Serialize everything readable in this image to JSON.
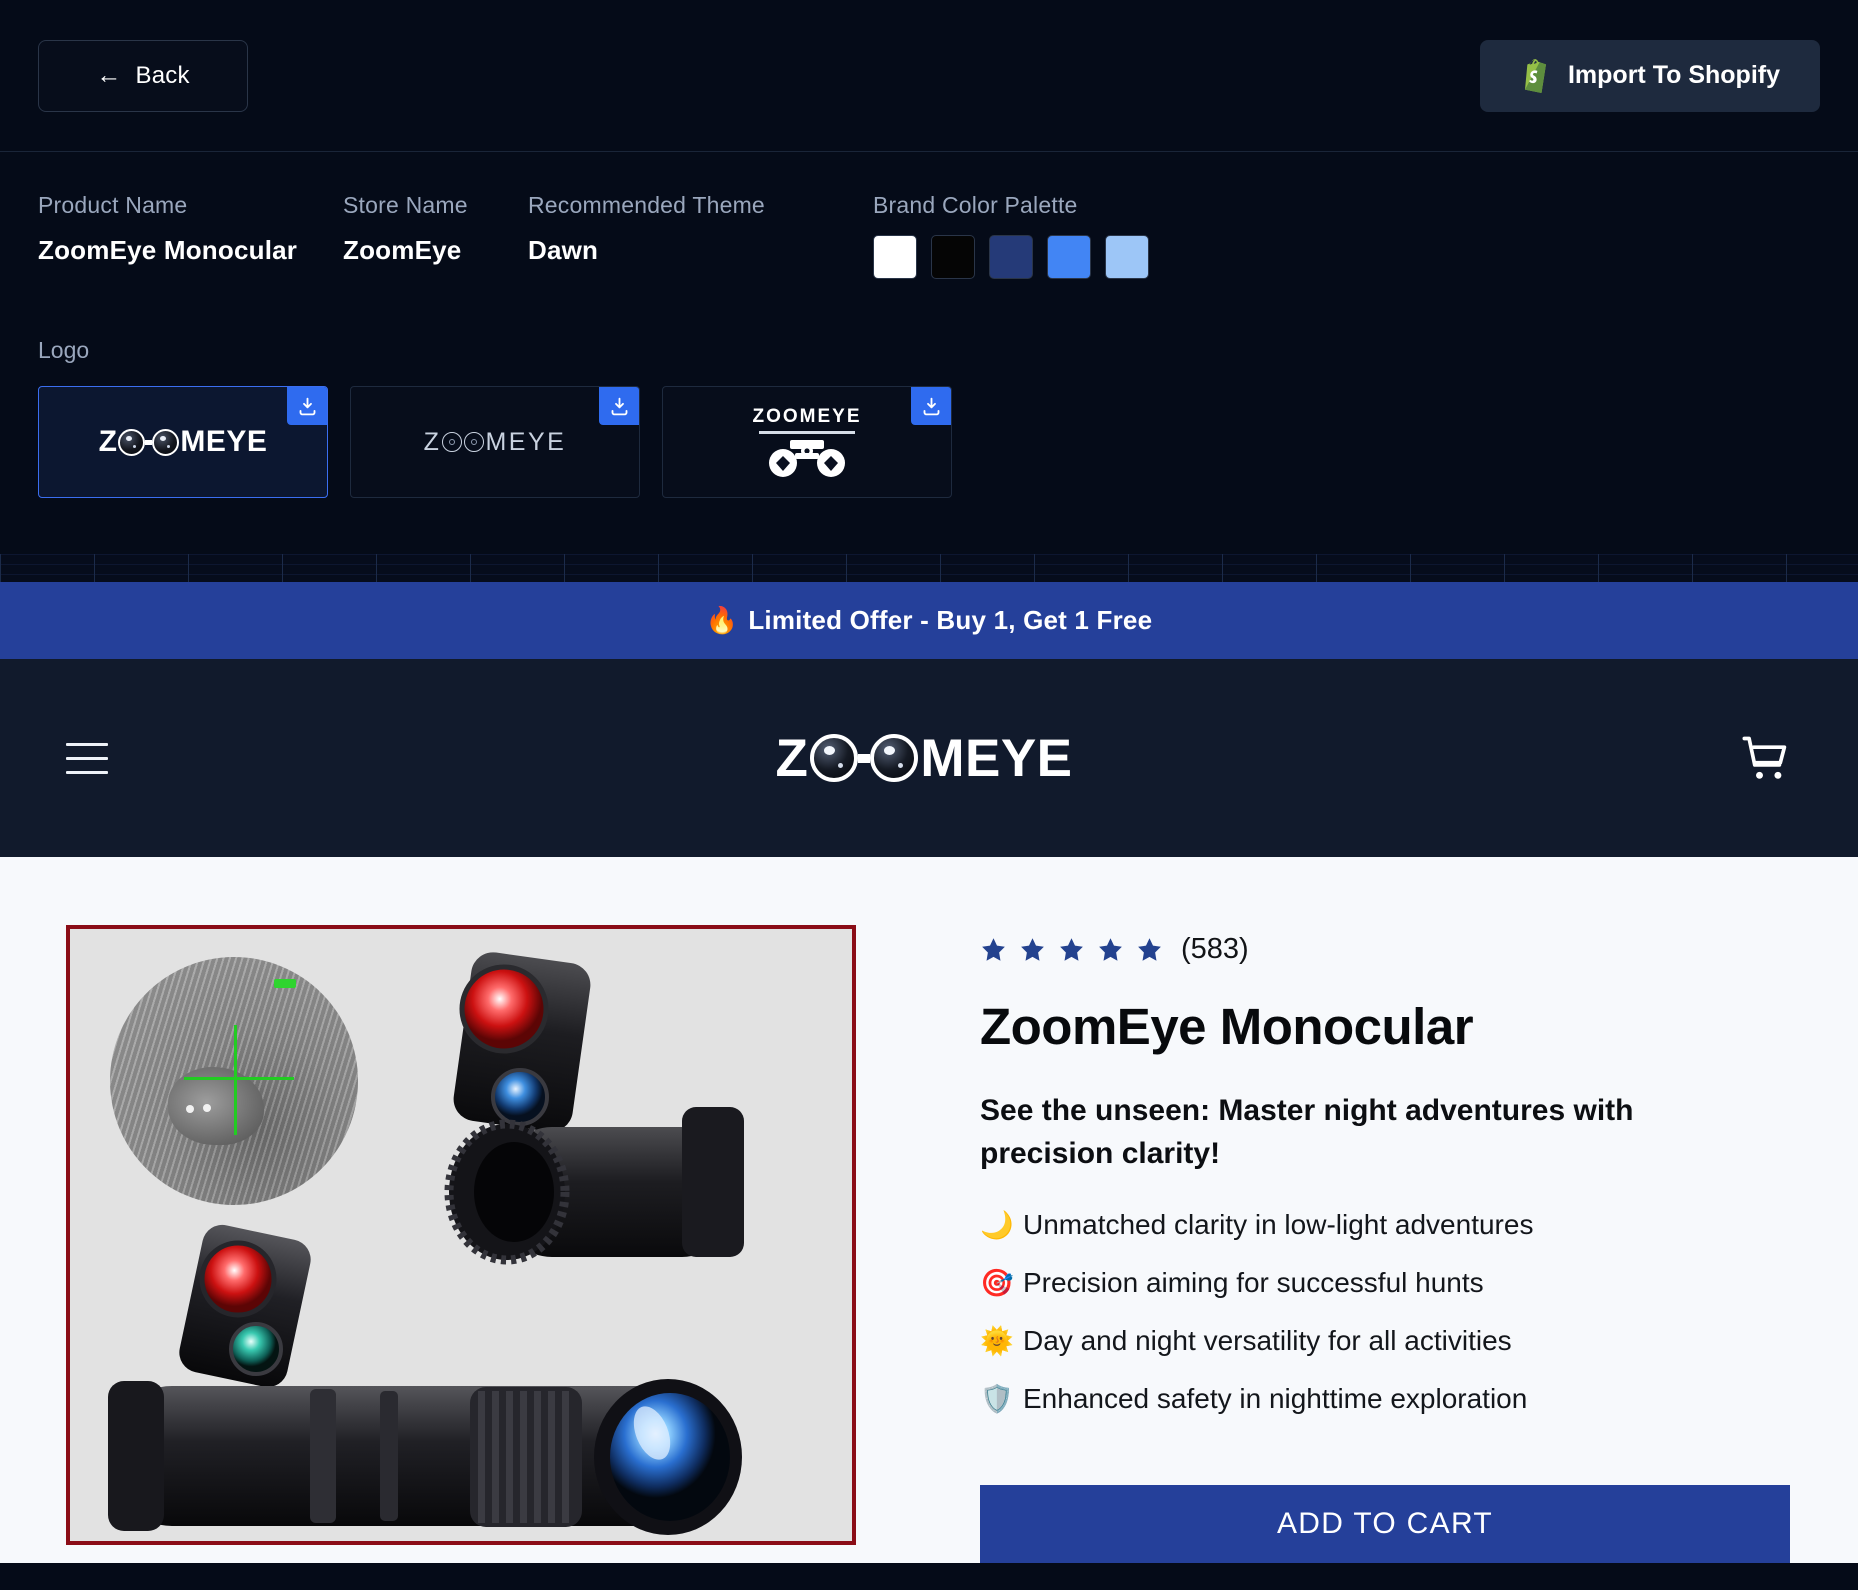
{
  "topbar": {
    "back_label": "Back",
    "back_icon": "arrow-left-icon",
    "import_label": "Import To Shopify",
    "import_icon": "shopify-bag-icon"
  },
  "meta": {
    "fields": [
      {
        "label": "Product Name",
        "value": "ZoomEye Monocular"
      },
      {
        "label": "Store Name",
        "value": "ZoomEye"
      },
      {
        "label": "Recommended Theme",
        "value": "Dawn"
      }
    ],
    "palette_label": "Brand Color Palette",
    "palette": [
      "#ffffff",
      "#050505",
      "#253a78",
      "#4285f4",
      "#9dc6f7"
    ]
  },
  "logo_section": {
    "label": "Logo",
    "download_icon": "download-icon",
    "cards": [
      {
        "name": "ZOOMEYE",
        "variant": "bold-binocular",
        "selected": true
      },
      {
        "name": "ZOOMEYE",
        "variant": "thin-outline",
        "selected": false
      },
      {
        "name": "ZOOMEYE",
        "variant": "stacked-device",
        "selected": false
      }
    ]
  },
  "promo": {
    "emoji": "🔥",
    "text": "Limited Offer - Buy 1, Get 1 Free"
  },
  "store_header": {
    "menu_icon": "hamburger-menu-icon",
    "logo_text": "ZOOMEYE",
    "cart_icon": "shopping-cart-icon"
  },
  "product": {
    "image_alt": "ZoomEye Monocular night vision product photo",
    "rating_stars": 5,
    "rating_count": "(583)",
    "title": "ZoomEye Monocular",
    "tagline": "See the unseen: Master night adventures with precision clarity!",
    "features": [
      {
        "emoji": "🌙",
        "text": "Unmatched clarity in low-light adventures"
      },
      {
        "emoji": "🎯",
        "text": "Precision aiming for successful hunts"
      },
      {
        "emoji": "🌞",
        "text": "Day and night versatility for all activities"
      },
      {
        "emoji": "🛡️",
        "text": "Enhanced safety in nighttime exploration"
      }
    ],
    "add_to_cart_label": "ADD TO CART"
  },
  "colors": {
    "app_bg": "#050b18",
    "store_header_bg": "#111a2c",
    "accent_blue": "#25409a",
    "download_blue": "#2f6bef",
    "product_bg": "#f7f9fc",
    "image_border": "#8b0d17",
    "star": "#23428f"
  }
}
